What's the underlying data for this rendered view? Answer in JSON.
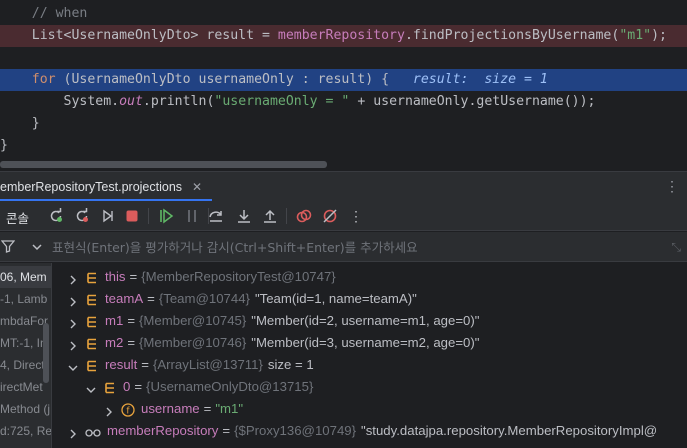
{
  "editor": {
    "lines": [
      {
        "type": "comment",
        "text": "    // when"
      },
      {
        "type": "code-error",
        "parts": [
          "    List<UsernameOnlyDto> result = ",
          "memberRepository",
          ".findProjectionsByUsername(",
          "\"m1\"",
          ");"
        ]
      },
      {
        "type": "blank"
      },
      {
        "type": "code-exec",
        "parts": [
          "    ",
          "for",
          " (UsernameOnlyDto usernameOnly : result) {   ",
          "result:  size = 1"
        ]
      },
      {
        "type": "code",
        "parts": [
          "        System.",
          "out",
          ".println(",
          "\"usernameOnly = \"",
          " + usernameOnly.getUsername());"
        ]
      },
      {
        "type": "code",
        "text": "    }"
      },
      {
        "type": "code",
        "text": "}"
      }
    ]
  },
  "debug": {
    "run_tab_label": "emberRepositoryTest.projections",
    "console_label": "콘솔",
    "eval_placeholder": "표현식(Enter)을 평가하거나 감시(Ctrl+Shift+Enter)를 추가하세요"
  },
  "frames": [
    "06, Mem",
    "-1, Lamb",
    "mbdaFor",
    "MT:-1, In",
    "4, Direct",
    "irectMet",
    "Method (j",
    "d:725, Re"
  ],
  "variables": [
    {
      "name": "this",
      "eq": "=",
      "type": "{MemberRepositoryTest@10747}",
      "value": "",
      "icon": "list-icon",
      "expand": "collapsed",
      "indent": 0
    },
    {
      "name": "teamA",
      "eq": "=",
      "type": "{Team@10744}",
      "value": "\"Team(id=1, name=teamA)\"",
      "icon": "list-icon",
      "expand": "collapsed",
      "indent": 0
    },
    {
      "name": "m1",
      "eq": "=",
      "type": "{Member@10745}",
      "value": "\"Member(id=2, username=m1, age=0)\"",
      "icon": "list-icon",
      "expand": "collapsed",
      "indent": 0
    },
    {
      "name": "m2",
      "eq": "=",
      "type": "{Member@10746}",
      "value": "\"Member(id=3, username=m2, age=0)\"",
      "icon": "list-icon",
      "expand": "collapsed",
      "indent": 0
    },
    {
      "name": "result",
      "eq": "=",
      "type": "{ArrayList@13711}",
      "value": "size = 1",
      "icon": "list-icon",
      "expand": "expanded",
      "indent": 0
    },
    {
      "name": "0",
      "eq": "=",
      "type": "{UsernameOnlyDto@13715}",
      "value": "",
      "icon": "list-icon",
      "expand": "expanded",
      "indent": 1
    },
    {
      "name": "username",
      "eq": "=",
      "type": "",
      "value": "\"m1\"",
      "icon": "field-icon",
      "expand": "collapsed",
      "indent": 2
    },
    {
      "name": "memberRepository",
      "eq": "=",
      "type": "{$Proxy136@10749}",
      "value": "\"study.datajpa.repository.MemberRepositoryImpl@",
      "icon": "glasses-icon",
      "expand": "collapsed",
      "indent": 0
    }
  ],
  "colors": {
    "accent": "#3574f0",
    "green": "#5fb865",
    "red": "#db5c5c",
    "orange": "#cf8e6d"
  }
}
